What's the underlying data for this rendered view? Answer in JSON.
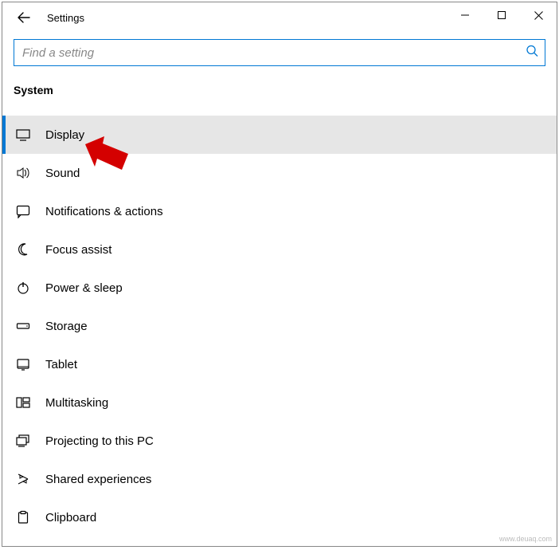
{
  "titlebar": {
    "title": "Settings"
  },
  "search": {
    "placeholder": "Find a setting"
  },
  "section": {
    "heading": "System"
  },
  "nav": {
    "items": [
      {
        "label": "Display",
        "icon": "display-icon",
        "selected": true
      },
      {
        "label": "Sound",
        "icon": "sound-icon",
        "selected": false
      },
      {
        "label": "Notifications & actions",
        "icon": "notifications-icon",
        "selected": false
      },
      {
        "label": "Focus assist",
        "icon": "focus-assist-icon",
        "selected": false
      },
      {
        "label": "Power & sleep",
        "icon": "power-icon",
        "selected": false
      },
      {
        "label": "Storage",
        "icon": "storage-icon",
        "selected": false
      },
      {
        "label": "Tablet",
        "icon": "tablet-icon",
        "selected": false
      },
      {
        "label": "Multitasking",
        "icon": "multitasking-icon",
        "selected": false
      },
      {
        "label": "Projecting to this PC",
        "icon": "projecting-icon",
        "selected": false
      },
      {
        "label": "Shared experiences",
        "icon": "shared-experiences-icon",
        "selected": false
      },
      {
        "label": "Clipboard",
        "icon": "clipboard-icon",
        "selected": false
      }
    ]
  },
  "watermark": "www.deuaq.com"
}
